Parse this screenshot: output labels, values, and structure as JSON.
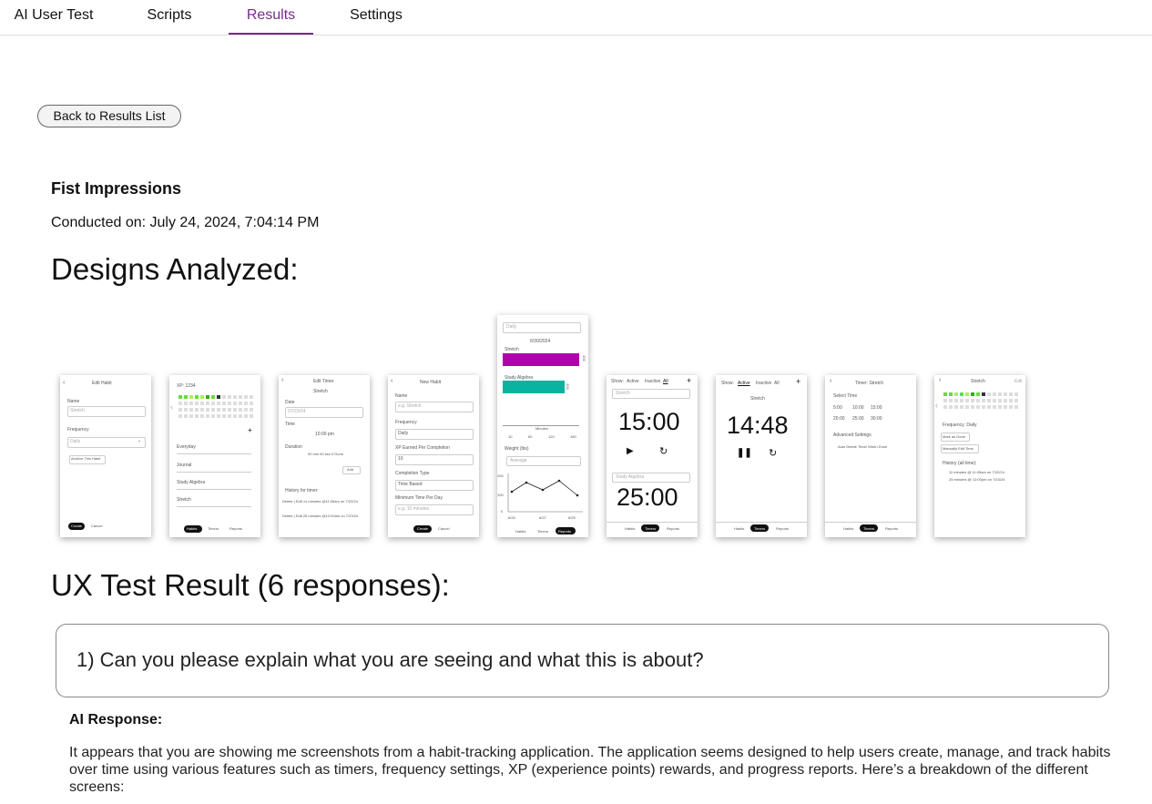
{
  "nav": {
    "tabs": [
      {
        "label": "AI User Test"
      },
      {
        "label": "Scripts"
      },
      {
        "label": "Results"
      },
      {
        "label": "Settings"
      }
    ],
    "active_tab": "Results",
    "accent": "#7a2a8c"
  },
  "back_button": "Back to Results List",
  "test": {
    "name": "Fist Impressions",
    "conducted": "Conducted on: July 24, 2024, 7:04:14 PM"
  },
  "designs_heading": "Designs Analyzed:",
  "thumbs": {
    "t1": {
      "title": "Edit Habit",
      "name_label": "Name",
      "name_value": "Stretch",
      "freq_label": "Frequency",
      "freq_value": "Daily",
      "archive": "Archive This Habit",
      "save": "Create",
      "cancel": "Cancel"
    },
    "t2": {
      "xp": "XP: 1234",
      "habits": [
        "Everyday",
        "Journal",
        "Study Algebra",
        "Stretch"
      ],
      "tabs": [
        "Habits",
        "Timers",
        "Reports"
      ]
    },
    "t3": {
      "title": "Edit Timer",
      "subtitle": "Stretch",
      "date_label": "Date",
      "date_value": "07/23/24",
      "time_label": "Time",
      "time_value": "10:00 pm",
      "duration_label": "Duration",
      "duration_value": "00 min 00 sec 0 Done",
      "add": "Add",
      "history": "History for timer:",
      "entries": [
        "Delete | Edit  14 minutes  @11:05am on 7/22/24",
        "Delete | Edit  25 minutes  @12:00am on 7/23/24"
      ]
    },
    "t4": {
      "title": "New Habit",
      "name_label": "Name",
      "name_value": "e.g. Stretch",
      "freq_label": "Frequency",
      "freq_value": "Daily",
      "xp_label": "XP Earned Per Completion",
      "xp_value": "10",
      "comp_label": "Completion Type",
      "comp_value": "Time Based",
      "min_label": "Minimum Time Per Day",
      "min_value": "e.g. 10 minutes",
      "save": "Create",
      "cancel": "Cancel"
    },
    "t5": {
      "select": "Daily",
      "date": "6/30/2024",
      "bar1_label": "Stretch",
      "bar1_value": "300",
      "bar2_label": "Study Algebra",
      "bar2_value": "200",
      "axis_ticks": [
        "10",
        "60",
        "120",
        "180"
      ],
      "axis_label": "Minutes",
      "chart_label": "Weight (lbs)",
      "chart_select": "Average",
      "x_ticks": [
        "6/25",
        "6/27",
        "6/29"
      ],
      "y_ticks": [
        "200",
        "100",
        "0"
      ],
      "tabs": [
        "Habits",
        "Timers",
        "Reports"
      ]
    },
    "t6": {
      "show": "Show:",
      "filters": [
        "Active",
        "Inactive",
        "All"
      ],
      "select1": "Stretch",
      "time1": "15:00",
      "select2": "Study Algebra",
      "time2": "25:00",
      "tabs": [
        "Habits",
        "Timers",
        "Reports"
      ]
    },
    "t7": {
      "show": "Show:",
      "filters": [
        "Active",
        "Inactive",
        "All"
      ],
      "name": "Stretch",
      "time": "14:48",
      "tabs": [
        "Habits",
        "Timers",
        "Reports"
      ]
    },
    "t8": {
      "title": "Timer: Stretch",
      "select_label": "Select Time",
      "times": [
        "5:00",
        "10:00",
        "15:00",
        "20:00",
        "25:00",
        "30:00"
      ],
      "advanced": "Advanced Settings",
      "auto": "Auto Delete Timer When Done",
      "tabs": [
        "Habits",
        "Timers",
        "Reports"
      ]
    },
    "t9": {
      "title": "Stretch",
      "edit": "Edit",
      "freq": "Frequency: Daily",
      "btn1": "Mark as Done",
      "btn2": "Manually Edit Time",
      "history": "History (all time):",
      "entries": [
        "11 minutes  @ 11:05am on 7/22/24",
        "25 minutes  @ 12:00pm on 7/23/24"
      ]
    }
  },
  "ux_heading": "UX Test Result (6 responses):",
  "question": "1) Can you please explain what you are seeing and what this is about?",
  "ai_label": "AI Response:",
  "ai_text": "It appears that you are showing me screenshots from a habit-tracking application. The application seems designed to help users create, manage, and track habits over time using various features such as timers, frequency settings, XP (experience points) rewards, and progress reports. Here’s a breakdown of the different screens:",
  "colors": {
    "bar1": "#b000b0",
    "bar2": "#0ab3a0",
    "grid_green": "#66dd44"
  }
}
